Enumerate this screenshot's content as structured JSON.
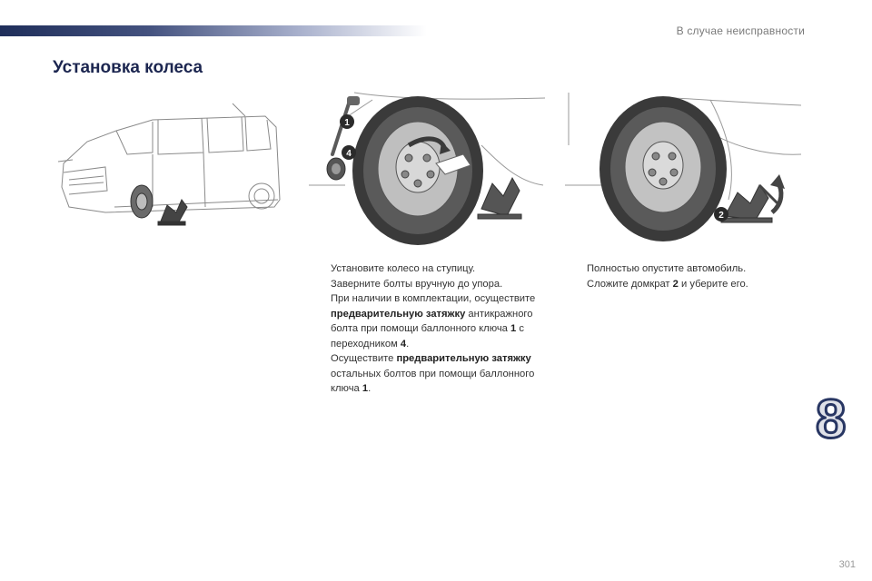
{
  "header": {
    "chapter": "В случае неисправности"
  },
  "title": "Установка колеса",
  "figures": {
    "tyre_tools": {
      "callout_wrench": "1",
      "callout_adapter": "4"
    },
    "tyre_jack": {
      "callout_jack": "2"
    }
  },
  "steps_left": [
    {
      "marker": "",
      "parts": [
        {
          "text": "Установите колесо на ступицу.",
          "bold": false
        }
      ]
    },
    {
      "marker": "",
      "parts": [
        {
          "text": "Заверните болты вручную до упора.",
          "bold": false
        }
      ]
    },
    {
      "marker": "",
      "parts": [
        {
          "text": "При наличии в комплектации, осуществите ",
          "bold": false
        },
        {
          "text": "предварительную затяжку",
          "bold": true
        },
        {
          "text": " антикражного болта при помощи баллонного ключа ",
          "bold": false
        },
        {
          "text": "1",
          "bold": true
        },
        {
          "text": " с переходником ",
          "bold": false
        },
        {
          "text": "4",
          "bold": true
        },
        {
          "text": ".",
          "bold": false
        }
      ]
    },
    {
      "marker": "",
      "parts": [
        {
          "text": "Осуществите ",
          "bold": false
        },
        {
          "text": "предварительную затяжку",
          "bold": true
        },
        {
          "text": " остальных болтов при помощи баллонного ключа ",
          "bold": false
        },
        {
          "text": "1",
          "bold": true
        },
        {
          "text": ".",
          "bold": false
        }
      ]
    }
  ],
  "steps_right": [
    {
      "marker": "",
      "parts": [
        {
          "text": "Полностью опустите автомобиль.",
          "bold": false
        }
      ]
    },
    {
      "marker": "",
      "parts": [
        {
          "text": "Сложите домкрат ",
          "bold": false
        },
        {
          "text": "2",
          "bold": true
        },
        {
          "text": " и уберите его.",
          "bold": false
        }
      ]
    }
  ],
  "chapter_number": "8",
  "page_number": "301",
  "colors": {
    "navy": "#1f2e5a",
    "callout": "#2b2b2b"
  }
}
